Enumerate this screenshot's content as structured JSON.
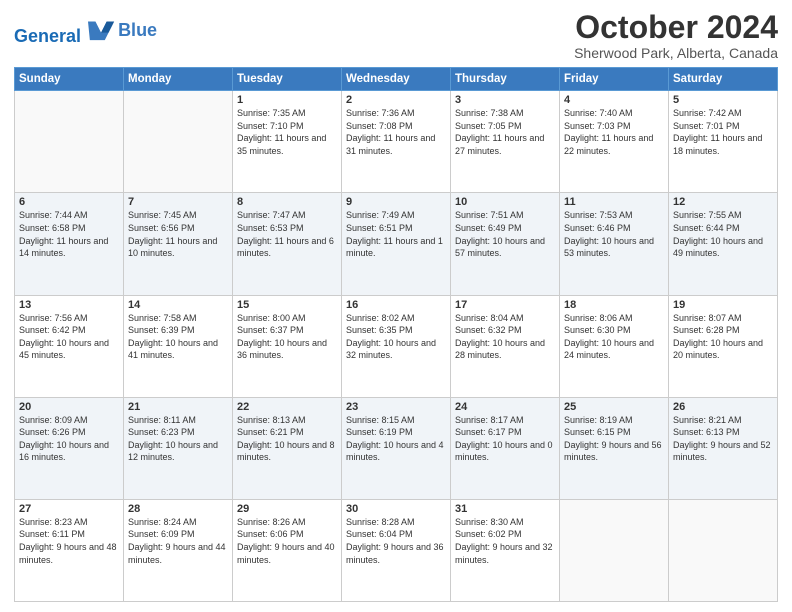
{
  "logo": {
    "line1": "General",
    "line2": "Blue"
  },
  "title": "October 2024",
  "subtitle": "Sherwood Park, Alberta, Canada",
  "days_of_week": [
    "Sunday",
    "Monday",
    "Tuesday",
    "Wednesday",
    "Thursday",
    "Friday",
    "Saturday"
  ],
  "weeks": [
    [
      {
        "day": "",
        "info": ""
      },
      {
        "day": "",
        "info": ""
      },
      {
        "day": "1",
        "info": "Sunrise: 7:35 AM\nSunset: 7:10 PM\nDaylight: 11 hours and 35 minutes."
      },
      {
        "day": "2",
        "info": "Sunrise: 7:36 AM\nSunset: 7:08 PM\nDaylight: 11 hours and 31 minutes."
      },
      {
        "day": "3",
        "info": "Sunrise: 7:38 AM\nSunset: 7:05 PM\nDaylight: 11 hours and 27 minutes."
      },
      {
        "day": "4",
        "info": "Sunrise: 7:40 AM\nSunset: 7:03 PM\nDaylight: 11 hours and 22 minutes."
      },
      {
        "day": "5",
        "info": "Sunrise: 7:42 AM\nSunset: 7:01 PM\nDaylight: 11 hours and 18 minutes."
      }
    ],
    [
      {
        "day": "6",
        "info": "Sunrise: 7:44 AM\nSunset: 6:58 PM\nDaylight: 11 hours and 14 minutes."
      },
      {
        "day": "7",
        "info": "Sunrise: 7:45 AM\nSunset: 6:56 PM\nDaylight: 11 hours and 10 minutes."
      },
      {
        "day": "8",
        "info": "Sunrise: 7:47 AM\nSunset: 6:53 PM\nDaylight: 11 hours and 6 minutes."
      },
      {
        "day": "9",
        "info": "Sunrise: 7:49 AM\nSunset: 6:51 PM\nDaylight: 11 hours and 1 minute."
      },
      {
        "day": "10",
        "info": "Sunrise: 7:51 AM\nSunset: 6:49 PM\nDaylight: 10 hours and 57 minutes."
      },
      {
        "day": "11",
        "info": "Sunrise: 7:53 AM\nSunset: 6:46 PM\nDaylight: 10 hours and 53 minutes."
      },
      {
        "day": "12",
        "info": "Sunrise: 7:55 AM\nSunset: 6:44 PM\nDaylight: 10 hours and 49 minutes."
      }
    ],
    [
      {
        "day": "13",
        "info": "Sunrise: 7:56 AM\nSunset: 6:42 PM\nDaylight: 10 hours and 45 minutes."
      },
      {
        "day": "14",
        "info": "Sunrise: 7:58 AM\nSunset: 6:39 PM\nDaylight: 10 hours and 41 minutes."
      },
      {
        "day": "15",
        "info": "Sunrise: 8:00 AM\nSunset: 6:37 PM\nDaylight: 10 hours and 36 minutes."
      },
      {
        "day": "16",
        "info": "Sunrise: 8:02 AM\nSunset: 6:35 PM\nDaylight: 10 hours and 32 minutes."
      },
      {
        "day": "17",
        "info": "Sunrise: 8:04 AM\nSunset: 6:32 PM\nDaylight: 10 hours and 28 minutes."
      },
      {
        "day": "18",
        "info": "Sunrise: 8:06 AM\nSunset: 6:30 PM\nDaylight: 10 hours and 24 minutes."
      },
      {
        "day": "19",
        "info": "Sunrise: 8:07 AM\nSunset: 6:28 PM\nDaylight: 10 hours and 20 minutes."
      }
    ],
    [
      {
        "day": "20",
        "info": "Sunrise: 8:09 AM\nSunset: 6:26 PM\nDaylight: 10 hours and 16 minutes."
      },
      {
        "day": "21",
        "info": "Sunrise: 8:11 AM\nSunset: 6:23 PM\nDaylight: 10 hours and 12 minutes."
      },
      {
        "day": "22",
        "info": "Sunrise: 8:13 AM\nSunset: 6:21 PM\nDaylight: 10 hours and 8 minutes."
      },
      {
        "day": "23",
        "info": "Sunrise: 8:15 AM\nSunset: 6:19 PM\nDaylight: 10 hours and 4 minutes."
      },
      {
        "day": "24",
        "info": "Sunrise: 8:17 AM\nSunset: 6:17 PM\nDaylight: 10 hours and 0 minutes."
      },
      {
        "day": "25",
        "info": "Sunrise: 8:19 AM\nSunset: 6:15 PM\nDaylight: 9 hours and 56 minutes."
      },
      {
        "day": "26",
        "info": "Sunrise: 8:21 AM\nSunset: 6:13 PM\nDaylight: 9 hours and 52 minutes."
      }
    ],
    [
      {
        "day": "27",
        "info": "Sunrise: 8:23 AM\nSunset: 6:11 PM\nDaylight: 9 hours and 48 minutes."
      },
      {
        "day": "28",
        "info": "Sunrise: 8:24 AM\nSunset: 6:09 PM\nDaylight: 9 hours and 44 minutes."
      },
      {
        "day": "29",
        "info": "Sunrise: 8:26 AM\nSunset: 6:06 PM\nDaylight: 9 hours and 40 minutes."
      },
      {
        "day": "30",
        "info": "Sunrise: 8:28 AM\nSunset: 6:04 PM\nDaylight: 9 hours and 36 minutes."
      },
      {
        "day": "31",
        "info": "Sunrise: 8:30 AM\nSunset: 6:02 PM\nDaylight: 9 hours and 32 minutes."
      },
      {
        "day": "",
        "info": ""
      },
      {
        "day": "",
        "info": ""
      }
    ]
  ]
}
